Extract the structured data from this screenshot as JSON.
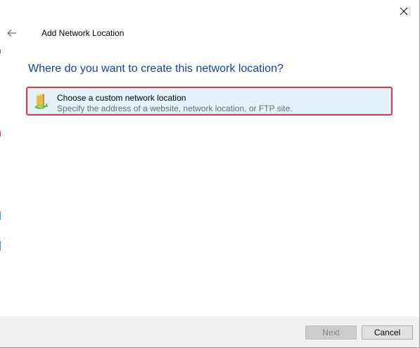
{
  "window": {
    "title": "Add Network Location",
    "close_icon": "close-icon",
    "back_icon": "back-arrow-icon"
  },
  "main": {
    "heading": "Where do you want to create this network location?",
    "options": [
      {
        "title": "Choose a custom network location",
        "description": "Specify the address of a website, network location, or FTP site.",
        "icon": "network-folder-icon",
        "selected": true
      }
    ]
  },
  "footer": {
    "next_label": "Next",
    "next_enabled": false,
    "cancel_label": "Cancel"
  },
  "colors": {
    "heading": "#1a3ea4",
    "option_background": "#e5f1fb",
    "option_border": "#e03a3e",
    "footer_background": "#f0f0f0"
  }
}
